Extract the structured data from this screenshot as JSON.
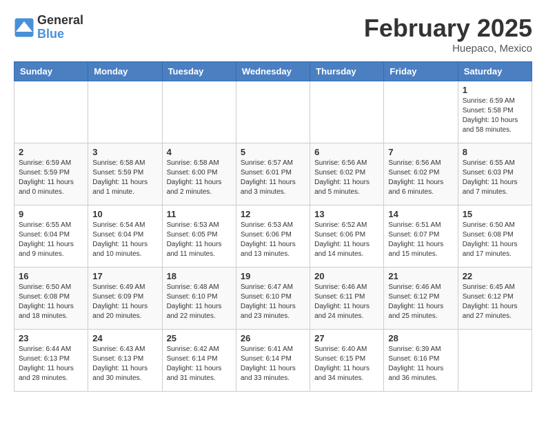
{
  "logo": {
    "general": "General",
    "blue": "Blue"
  },
  "title": "February 2025",
  "location": "Huepaco, Mexico",
  "weekdays": [
    "Sunday",
    "Monday",
    "Tuesday",
    "Wednesday",
    "Thursday",
    "Friday",
    "Saturday"
  ],
  "weeks": [
    [
      {
        "day": "",
        "info": ""
      },
      {
        "day": "",
        "info": ""
      },
      {
        "day": "",
        "info": ""
      },
      {
        "day": "",
        "info": ""
      },
      {
        "day": "",
        "info": ""
      },
      {
        "day": "",
        "info": ""
      },
      {
        "day": "1",
        "info": "Sunrise: 6:59 AM\nSunset: 5:58 PM\nDaylight: 10 hours\nand 58 minutes."
      }
    ],
    [
      {
        "day": "2",
        "info": "Sunrise: 6:59 AM\nSunset: 5:59 PM\nDaylight: 11 hours\nand 0 minutes."
      },
      {
        "day": "3",
        "info": "Sunrise: 6:58 AM\nSunset: 5:59 PM\nDaylight: 11 hours\nand 1 minute."
      },
      {
        "day": "4",
        "info": "Sunrise: 6:58 AM\nSunset: 6:00 PM\nDaylight: 11 hours\nand 2 minutes."
      },
      {
        "day": "5",
        "info": "Sunrise: 6:57 AM\nSunset: 6:01 PM\nDaylight: 11 hours\nand 3 minutes."
      },
      {
        "day": "6",
        "info": "Sunrise: 6:56 AM\nSunset: 6:02 PM\nDaylight: 11 hours\nand 5 minutes."
      },
      {
        "day": "7",
        "info": "Sunrise: 6:56 AM\nSunset: 6:02 PM\nDaylight: 11 hours\nand 6 minutes."
      },
      {
        "day": "8",
        "info": "Sunrise: 6:55 AM\nSunset: 6:03 PM\nDaylight: 11 hours\nand 7 minutes."
      }
    ],
    [
      {
        "day": "9",
        "info": "Sunrise: 6:55 AM\nSunset: 6:04 PM\nDaylight: 11 hours\nand 9 minutes."
      },
      {
        "day": "10",
        "info": "Sunrise: 6:54 AM\nSunset: 6:04 PM\nDaylight: 11 hours\nand 10 minutes."
      },
      {
        "day": "11",
        "info": "Sunrise: 6:53 AM\nSunset: 6:05 PM\nDaylight: 11 hours\nand 11 minutes."
      },
      {
        "day": "12",
        "info": "Sunrise: 6:53 AM\nSunset: 6:06 PM\nDaylight: 11 hours\nand 13 minutes."
      },
      {
        "day": "13",
        "info": "Sunrise: 6:52 AM\nSunset: 6:06 PM\nDaylight: 11 hours\nand 14 minutes."
      },
      {
        "day": "14",
        "info": "Sunrise: 6:51 AM\nSunset: 6:07 PM\nDaylight: 11 hours\nand 15 minutes."
      },
      {
        "day": "15",
        "info": "Sunrise: 6:50 AM\nSunset: 6:08 PM\nDaylight: 11 hours\nand 17 minutes."
      }
    ],
    [
      {
        "day": "16",
        "info": "Sunrise: 6:50 AM\nSunset: 6:08 PM\nDaylight: 11 hours\nand 18 minutes."
      },
      {
        "day": "17",
        "info": "Sunrise: 6:49 AM\nSunset: 6:09 PM\nDaylight: 11 hours\nand 20 minutes."
      },
      {
        "day": "18",
        "info": "Sunrise: 6:48 AM\nSunset: 6:10 PM\nDaylight: 11 hours\nand 22 minutes."
      },
      {
        "day": "19",
        "info": "Sunrise: 6:47 AM\nSunset: 6:10 PM\nDaylight: 11 hours\nand 23 minutes."
      },
      {
        "day": "20",
        "info": "Sunrise: 6:46 AM\nSunset: 6:11 PM\nDaylight: 11 hours\nand 24 minutes."
      },
      {
        "day": "21",
        "info": "Sunrise: 6:46 AM\nSunset: 6:12 PM\nDaylight: 11 hours\nand 25 minutes."
      },
      {
        "day": "22",
        "info": "Sunrise: 6:45 AM\nSunset: 6:12 PM\nDaylight: 11 hours\nand 27 minutes."
      }
    ],
    [
      {
        "day": "23",
        "info": "Sunrise: 6:44 AM\nSunset: 6:13 PM\nDaylight: 11 hours\nand 28 minutes."
      },
      {
        "day": "24",
        "info": "Sunrise: 6:43 AM\nSunset: 6:13 PM\nDaylight: 11 hours\nand 30 minutes."
      },
      {
        "day": "25",
        "info": "Sunrise: 6:42 AM\nSunset: 6:14 PM\nDaylight: 11 hours\nand 31 minutes."
      },
      {
        "day": "26",
        "info": "Sunrise: 6:41 AM\nSunset: 6:14 PM\nDaylight: 11 hours\nand 33 minutes."
      },
      {
        "day": "27",
        "info": "Sunrise: 6:40 AM\nSunset: 6:15 PM\nDaylight: 11 hours\nand 34 minutes."
      },
      {
        "day": "28",
        "info": "Sunrise: 6:39 AM\nSunset: 6:16 PM\nDaylight: 11 hours\nand 36 minutes."
      },
      {
        "day": "",
        "info": ""
      }
    ]
  ]
}
